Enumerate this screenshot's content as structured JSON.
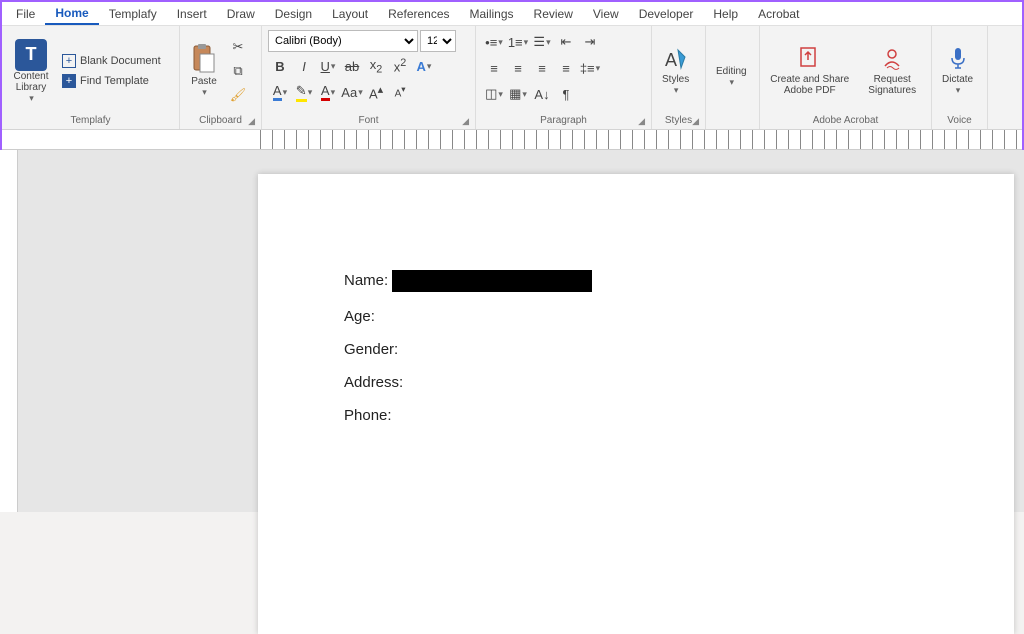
{
  "tabs": {
    "file": "File",
    "home": "Home",
    "templafy": "Templafy",
    "insert": "Insert",
    "draw": "Draw",
    "design": "Design",
    "layout": "Layout",
    "references": "References",
    "mailings": "Mailings",
    "review": "Review",
    "view": "View",
    "developer": "Developer",
    "help": "Help",
    "acrobat": "Acrobat"
  },
  "templafy_group": {
    "label": "Templafy",
    "content_library": "Content Library",
    "blank_doc": "Blank Document",
    "find_template": "Find Template"
  },
  "clipboard_group": {
    "label": "Clipboard",
    "paste": "Paste"
  },
  "font_group": {
    "label": "Font",
    "font_name": "Calibri (Body)",
    "font_size": "12"
  },
  "paragraph_group": {
    "label": "Paragraph"
  },
  "styles_group": {
    "label": "Styles",
    "styles": "Styles"
  },
  "editing_group": {
    "label": "",
    "editing": "Editing"
  },
  "acrobat_group": {
    "label": "Adobe Acrobat",
    "create_share1": "Create and Share",
    "create_share2": "Adobe PDF",
    "req_sig1": "Request",
    "req_sig2": "Signatures"
  },
  "voice_group": {
    "label": "Voice",
    "dictate": "Dictate"
  },
  "document": {
    "name_label": "Name:",
    "age_label": "Age:",
    "gender_label": "Gender:",
    "address_label": "Address:",
    "phone_label": "Phone:"
  }
}
